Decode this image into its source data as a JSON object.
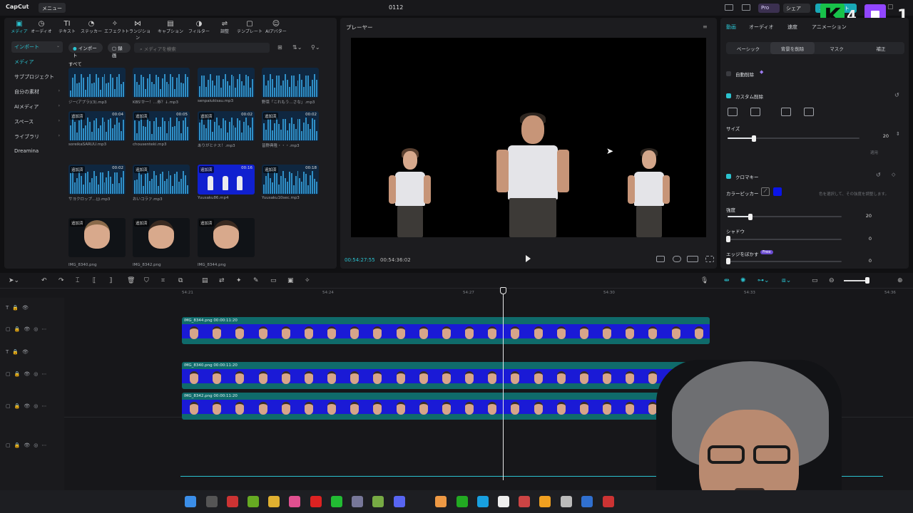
{
  "title_bar": {
    "app_name": "CapCut",
    "menu_label": "メニュー",
    "project_name": "0112",
    "pro_label": "Pro",
    "share_label": "シェア",
    "export_label": "エクスポート"
  },
  "media_panel": {
    "tabs": [
      {
        "label": "メディア",
        "icon": "▣"
      },
      {
        "label": "オーディオ",
        "icon": "◷"
      },
      {
        "label": "テキスト",
        "icon": "TI"
      },
      {
        "label": "ステッカー",
        "icon": "◔"
      },
      {
        "label": "エフェクト",
        "icon": "✧"
      },
      {
        "label": "トランジション",
        "icon": "⋈"
      },
      {
        "label": "キャプション",
        "icon": "▤"
      },
      {
        "label": "フィルター",
        "icon": "◑"
      },
      {
        "label": "調整",
        "icon": "⇌"
      },
      {
        "label": "テンプレート",
        "icon": "▢"
      },
      {
        "label": "AIアバター",
        "icon": "☺"
      }
    ],
    "sidebar": [
      {
        "label": "インポート",
        "state": "active",
        "chevron": "⌄"
      },
      {
        "label": "メディア",
        "state": "sub",
        "chevron": ""
      },
      {
        "label": "サブプロジェクト",
        "state": "",
        "chevron": ""
      },
      {
        "label": "自分の素材",
        "state": "",
        "chevron": "›"
      },
      {
        "label": "AIメディア",
        "state": "",
        "chevron": "›"
      },
      {
        "label": "スペース",
        "state": "",
        "chevron": "›"
      },
      {
        "label": "ライブラリ",
        "state": "",
        "chevron": "›"
      },
      {
        "label": "Dreamina",
        "state": "",
        "chevron": ""
      }
    ],
    "import_pill": "インポート",
    "record_pill": "録画",
    "search_placeholder": "メディアを検索",
    "all_label": "すべて",
    "added_badge": "追加済",
    "items": [
      {
        "kind": "audio",
        "caption": "ジー(アプラ)(3).mp3",
        "added": false,
        "duration": ""
      },
      {
        "kind": "audio",
        "caption": "KBS'かー！…券？↓.mp3",
        "added": false,
        "duration": ""
      },
      {
        "kind": "audio",
        "caption": "senpaiukisau.mp3",
        "added": false,
        "duration": ""
      },
      {
        "kind": "audio",
        "caption": "野菜「これもう…さな」.mp3",
        "added": false,
        "duration": ""
      },
      {
        "kind": "audio",
        "caption": "soreikaSARUU.mp3",
        "added": true,
        "duration": "00:04"
      },
      {
        "kind": "audio",
        "caption": "chousenteki.mp3",
        "added": true,
        "duration": "00:05"
      },
      {
        "kind": "audio",
        "caption": "ありがとナス！.mp3",
        "added": true,
        "duration": "00:02"
      },
      {
        "kind": "audio",
        "caption": "皆野典隆・・・.mp3",
        "added": true,
        "duration": "00:02"
      },
      {
        "kind": "audio",
        "caption": "サヨクロップ…(j).mp3",
        "added": true,
        "duration": "00:02"
      },
      {
        "kind": "audio",
        "caption": "おいコラァ.mp3",
        "added": true,
        "duration": ""
      },
      {
        "kind": "video",
        "caption": "Yuusaku86.mp4",
        "added": true,
        "duration": "00:16"
      },
      {
        "kind": "audio",
        "caption": "Yuusaku10sec.mp3",
        "added": true,
        "duration": "00:18"
      },
      {
        "kind": "image",
        "caption": "IMG_8340.png",
        "added": true,
        "duration": ""
      },
      {
        "kind": "image",
        "caption": "IMG_8342.png",
        "added": true,
        "duration": ""
      },
      {
        "kind": "image",
        "caption": "IMG_8344.png",
        "added": true,
        "duration": ""
      }
    ]
  },
  "player": {
    "title": "プレーヤー",
    "current_time": "00:54:27:55",
    "total_time": "00:54:36:02"
  },
  "properties": {
    "tabs": [
      {
        "label": "動画",
        "state": "active"
      },
      {
        "label": "オーディオ",
        "state": ""
      },
      {
        "label": "速度",
        "state": ""
      },
      {
        "label": "アニメーション",
        "state": ""
      }
    ],
    "subtabs": [
      {
        "label": "ベーシック",
        "state": ""
      },
      {
        "label": "背景を削除",
        "state": "active"
      },
      {
        "label": "マスク",
        "state": ""
      },
      {
        "label": "補正",
        "state": ""
      }
    ],
    "auto_remove_label": "自動削除",
    "custom_remove_label": "カスタム削除",
    "size_label": "サイズ",
    "size_value": "20",
    "size_level": 0.2,
    "apply_label": "適用",
    "chroma_label": "クロマキー",
    "color_picker_label": "カラーピッカー",
    "color_hint": "色を選択して、その強度を調整します。",
    "picked_color": "#0a14e8",
    "strength_label": "強度",
    "strength_value": "20",
    "strength_level": 0.2,
    "shadow_label": "シャドウ",
    "shadow_value": "0",
    "feather_label": "エッジをぼかす",
    "feather_value": "0",
    "free_badge": "Free"
  },
  "timeline": {
    "ruler_ticks": [
      "54:21",
      "54:24",
      "54:27",
      "54:30",
      "54:33",
      "54:36"
    ],
    "clips": [
      {
        "label": "IMG_8344.png  00:00:11:20",
        "track": 1
      },
      {
        "label": "IMG_8340.png  00:00:11:20",
        "track": 3
      },
      {
        "label": "IMG_8342.png  00:00:11:20",
        "track": 4
      }
    ]
  },
  "overlay": {
    "k_label": "K",
    "k_number": "4",
    "corner_number": "1"
  },
  "taskbar": {
    "icons": [
      "windows-start-icon",
      "task-view-icon",
      "chrome-dev-icon",
      "nvidia-icon",
      "file-explorer-icon",
      "lips-app-icon",
      "obs-icon",
      "line-icon",
      "chatgpt-icon",
      "vim-icon",
      "discord-icon",
      "app-icon",
      "xbox-icon",
      "edge-icon",
      "chrome-icon",
      "capcut-icon",
      "github-icon",
      "bitcoin-icon",
      "security-icon",
      "paint-icon"
    ]
  },
  "colors": {
    "accent": "#2bc3d0",
    "clip_bg": "#0f6b6b",
    "chroma_blue": "#1a1ad6"
  }
}
